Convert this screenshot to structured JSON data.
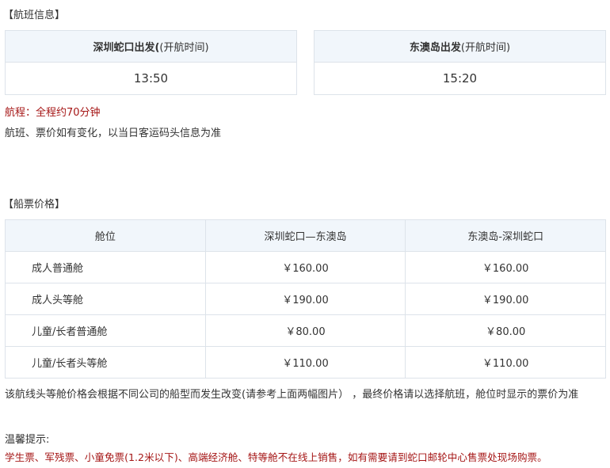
{
  "schedule_section": {
    "title": "【航班信息】",
    "departures": [
      {
        "label_bold": "深圳蛇口出发(",
        "label_normal": "(开航时间)",
        "time": "13:50"
      },
      {
        "label_bold": "东澳岛出发",
        "label_normal": "(开航时间)",
        "time": "15:20"
      }
    ],
    "duration": "航程：全程约70分钟",
    "notice": "航班、票价如有变化，以当日客运码头信息为准"
  },
  "price_section": {
    "title": "【船票价格】",
    "headers": [
      "舱位",
      "深圳蛇口—东澳岛",
      "东澳岛-深圳蛇口"
    ],
    "rows": [
      [
        "成人普通舱",
        "￥160.00",
        "￥160.00"
      ],
      [
        "成人头等舱",
        "￥190.00",
        "￥190.00"
      ],
      [
        "儿童/长者普通舱",
        "￥80.00",
        "￥80.00"
      ],
      [
        "儿童/长者头等舱",
        "￥110.00",
        "￥110.00"
      ]
    ],
    "note": "该航线头等舱价格会根据不同公司的船型而发生改变(请参考上面两幅图片） ，最终价格请以选择航班，舱位时显示的票价为准"
  },
  "tips": {
    "title": "温馨提示:",
    "text": "学生票、军残票、小童免票(1.2米以下)、高端经济舱、特等舱不在线上销售，如有需要请到蛇口邮轮中心售票处现场购票。"
  },
  "colors": {
    "accent_red": "#a51616",
    "header_bg": "#f1f6fb",
    "border": "#dde3ea"
  }
}
